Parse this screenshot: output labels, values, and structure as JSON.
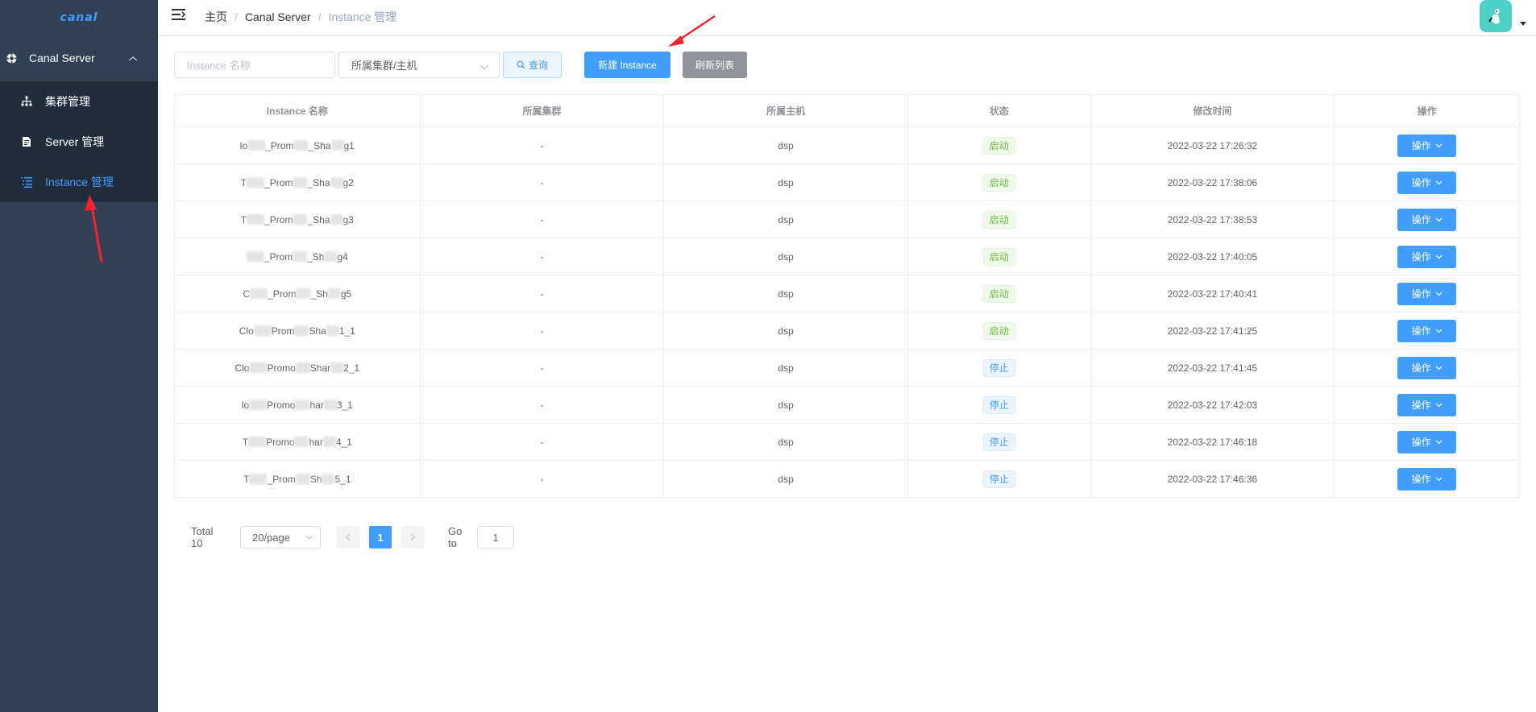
{
  "app": {
    "logo_text": "canal"
  },
  "sidebar": {
    "group_label": "Canal Server",
    "items": [
      {
        "label": "集群管理",
        "icon": "sitemap-icon",
        "active": false
      },
      {
        "label": "Server 管理",
        "icon": "document-icon",
        "active": false
      },
      {
        "label": "Instance 管理",
        "icon": "list-icon",
        "active": true
      }
    ]
  },
  "header": {
    "breadcrumb": [
      "主页",
      "Canal Server",
      "Instance 管理"
    ]
  },
  "toolbar": {
    "name_input_placeholder": "Instance 名称",
    "cluster_select_value": "所属集群/主机",
    "query_label": "查询",
    "new_instance_label": "新建 Instance",
    "refresh_label": "刷新列表"
  },
  "table": {
    "columns": [
      "Instance 名称",
      "所属集群",
      "所属主机",
      "状态",
      "修改时间",
      "操作"
    ],
    "rows": [
      {
        "name_pre": "lo",
        "name_mid": "_Prom",
        "name_mid2": "_Sha",
        "name_suffix": "g1",
        "cluster": "-",
        "host": "dsp",
        "status": "启动",
        "status_type": "success",
        "modified": "2022-03-22 17:26:32",
        "op": "操作"
      },
      {
        "name_pre": "T",
        "name_mid": "_Prom",
        "name_mid2": "_Sha",
        "name_suffix": "g2",
        "cluster": "-",
        "host": "dsp",
        "status": "启动",
        "status_type": "success",
        "modified": "2022-03-22 17:38:06",
        "op": "操作"
      },
      {
        "name_pre": "T",
        "name_mid": "_Prom",
        "name_mid2": "_Sha",
        "name_suffix": "g3",
        "cluster": "-",
        "host": "dsp",
        "status": "启动",
        "status_type": "success",
        "modified": "2022-03-22 17:38:53",
        "op": "操作"
      },
      {
        "name_pre": "",
        "name_mid": "_Prom",
        "name_mid2": "_Sh",
        "name_suffix": "g4",
        "cluster": "-",
        "host": "dsp",
        "status": "启动",
        "status_type": "success",
        "modified": "2022-03-22 17:40:05",
        "op": "操作"
      },
      {
        "name_pre": "C",
        "name_mid": "_Prom",
        "name_mid2": "_Sh",
        "name_suffix": "g5",
        "cluster": "-",
        "host": "dsp",
        "status": "启动",
        "status_type": "success",
        "modified": "2022-03-22 17:40:41",
        "op": "操作"
      },
      {
        "name_pre": "Clo",
        "name_mid": "Prom",
        "name_mid2": "Sha",
        "name_suffix": "1_1",
        "cluster": "-",
        "host": "dsp",
        "status": "启动",
        "status_type": "success",
        "modified": "2022-03-22 17:41:25",
        "op": "操作"
      },
      {
        "name_pre": "Clo",
        "name_mid": "Promo",
        "name_mid2": "Shar",
        "name_suffix": "2_1",
        "cluster": "-",
        "host": "dsp",
        "status": "停止",
        "status_type": "stop",
        "modified": "2022-03-22 17:41:45",
        "op": "操作"
      },
      {
        "name_pre": "lo",
        "name_mid": "Promo",
        "name_mid2": "har",
        "name_suffix": "3_1",
        "cluster": "-",
        "host": "dsp",
        "status": "停止",
        "status_type": "stop",
        "modified": "2022-03-22 17:42:03",
        "op": "操作"
      },
      {
        "name_pre": "T",
        "name_mid": "Promo",
        "name_mid2": "har",
        "name_suffix": "4_1",
        "cluster": "-",
        "host": "dsp",
        "status": "停止",
        "status_type": "stop",
        "modified": "2022-03-22 17:46:18",
        "op": "操作"
      },
      {
        "name_pre": "T",
        "name_mid": "_Prom",
        "name_mid2": "Sh",
        "name_suffix": "5_1",
        "cluster": "-",
        "host": "dsp",
        "status": "停止",
        "status_type": "stop",
        "modified": "2022-03-22 17:46:36",
        "op": "操作"
      }
    ]
  },
  "pagination": {
    "total_label": "Total 10",
    "page_size": "20/page",
    "current_page": "1",
    "goto_label": "Go to",
    "goto_value": "1"
  },
  "colors": {
    "sidebar_bg": "#304156",
    "submenu_bg": "#1f2d3d",
    "primary": "#409eff",
    "success": "#67c23a",
    "info": "#909399",
    "annotation_arrow": "#f5222d"
  }
}
